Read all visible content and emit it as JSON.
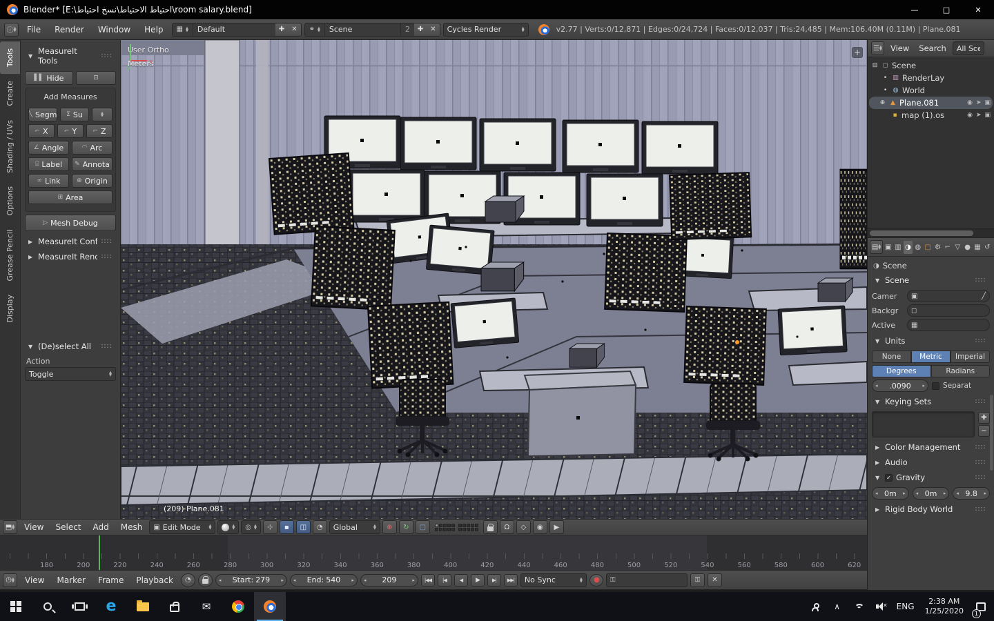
{
  "titlebar": {
    "title": "Blender* [E:\\احتياط الاحتياط\\نسخ احتياط\\room salary.blend]"
  },
  "infobar": {
    "menus": [
      "File",
      "Render",
      "Window",
      "Help"
    ],
    "screen_layout": "Default",
    "scene_name": "Scene",
    "scene_users": "2",
    "render_engine": "Cycles Render",
    "stats": "v2.77 | Verts:0/12,871 | Edges:0/24,724 | Faces:0/12,037 | Tris:24,485 | Mem:106.40M (0.11M) | Plane.081"
  },
  "toolshelf": {
    "tabs": [
      "Tools",
      "Create",
      "Shading / UVs",
      "Options",
      "Grease Pencil",
      "Display"
    ],
    "panel_measureit": "MeasureIt Tools",
    "hide": "Hide",
    "add_measures": "Add Measures",
    "segment": "Segm",
    "sum": "Su",
    "x": "X",
    "y": "Y",
    "z": "Z",
    "angle": "Angle",
    "arc": "Arc",
    "label": "Label",
    "annotate": "Annota",
    "link": "Link",
    "origin": "Origin",
    "area": "Area",
    "mesh_debug": "Mesh Debug",
    "panel_config": "MeasureIt Configura",
    "panel_render": "MeasureIt Render...",
    "panel_deselect": "(De)select All",
    "action_label": "Action",
    "action_value": "Toggle"
  },
  "viewport": {
    "view_name": "User Ortho",
    "units": "Meters",
    "object_info": "(209) Plane.081",
    "menus": [
      "View",
      "Select",
      "Add",
      "Mesh"
    ],
    "mode": "Edit Mode",
    "orientation": "Global"
  },
  "timeline": {
    "menus": [
      "View",
      "Marker",
      "Frame",
      "Playback"
    ],
    "start_label": "Start:",
    "start_value": "279",
    "end_label": "End:",
    "end_value": "540",
    "frame": "209",
    "sync": "No Sync",
    "ruler": [
      "180",
      "200",
      "220",
      "240",
      "260",
      "280",
      "300",
      "320",
      "340",
      "360",
      "380",
      "400",
      "420",
      "440",
      "460",
      "480",
      "500",
      "520",
      "540",
      "560",
      "580",
      "600",
      "620"
    ]
  },
  "outliner": {
    "menus": [
      "View",
      "Search"
    ],
    "filter": "All Sce",
    "items": [
      {
        "label": "Scene"
      },
      {
        "label": "RenderLay"
      },
      {
        "label": "World"
      },
      {
        "label": "Plane.081"
      },
      {
        "label": "map (1).os"
      }
    ]
  },
  "properties": {
    "breadcrumb": "Scene",
    "scene": {
      "title": "Scene",
      "camera_label": "Camer",
      "background_label": "Backgr",
      "active_label": "Active"
    },
    "units": {
      "title": "Units",
      "none": "None",
      "metric": "Metric",
      "imperial": "Imperial",
      "degrees": "Degrees",
      "radians": "Radians",
      "scale_value": ".0090",
      "separate_label": "Separat"
    },
    "keying": {
      "title": "Keying Sets"
    },
    "color_management": "Color Management",
    "audio": "Audio",
    "gravity": {
      "title": "Gravity",
      "x": "0m",
      "y": "0m",
      "z": "9.8"
    },
    "rigid_body": "Rigid Body World"
  },
  "taskbar": {
    "language": "ENG",
    "time": "2:38 AM",
    "date": "1/25/2020",
    "badge": "1"
  }
}
